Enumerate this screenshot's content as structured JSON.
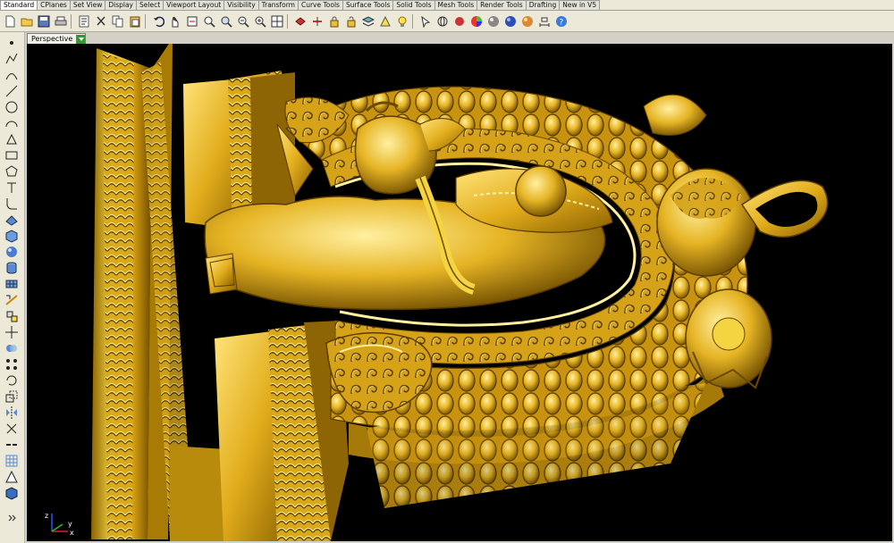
{
  "tabs": [
    {
      "label": "Standard",
      "active": true
    },
    {
      "label": "CPlanes"
    },
    {
      "label": "Set View"
    },
    {
      "label": "Display"
    },
    {
      "label": "Select"
    },
    {
      "label": "Viewport Layout"
    },
    {
      "label": "Visibility"
    },
    {
      "label": "Transform"
    },
    {
      "label": "Curve Tools"
    },
    {
      "label": "Surface Tools"
    },
    {
      "label": "Solid Tools"
    },
    {
      "label": "Mesh Tools"
    },
    {
      "label": "Render Tools"
    },
    {
      "label": "Drafting"
    },
    {
      "label": "New in V5"
    }
  ],
  "toolbar_icons": [
    "new-file-icon",
    "open-folder-icon",
    "save-icon",
    "print-icon",
    "properties-icon",
    "cut-icon",
    "copy-icon",
    "paste-icon",
    "undo-icon",
    "pan-icon",
    "rotate-view-icon",
    "zoom-icon",
    "zoom-window-icon",
    "zoom-extents-icon",
    "zoom-selected-icon",
    "four-viewports-icon",
    "hide-icon",
    "show-icon",
    "lock-icon",
    "unlock-icon",
    "layers-icon",
    "osnap-icon",
    "light-icon",
    "select-icon",
    "wireframe-icon",
    "shaded-icon",
    "color-wheel-icon",
    "render-sphere-icon",
    "material-sphere-icon",
    "render-icon",
    "dim-icon",
    "help-icon"
  ],
  "viewport": {
    "label": "Perspective",
    "background": "#000000"
  },
  "axes": {
    "x": "x",
    "y": "y",
    "z": "z"
  },
  "colors": {
    "gold_light": "#f7d84a",
    "gold_mid": "#d9a91a",
    "gold_dark": "#6b4a00",
    "chrome": "#ece9d8",
    "active_view_green": "#2f9a2f"
  }
}
